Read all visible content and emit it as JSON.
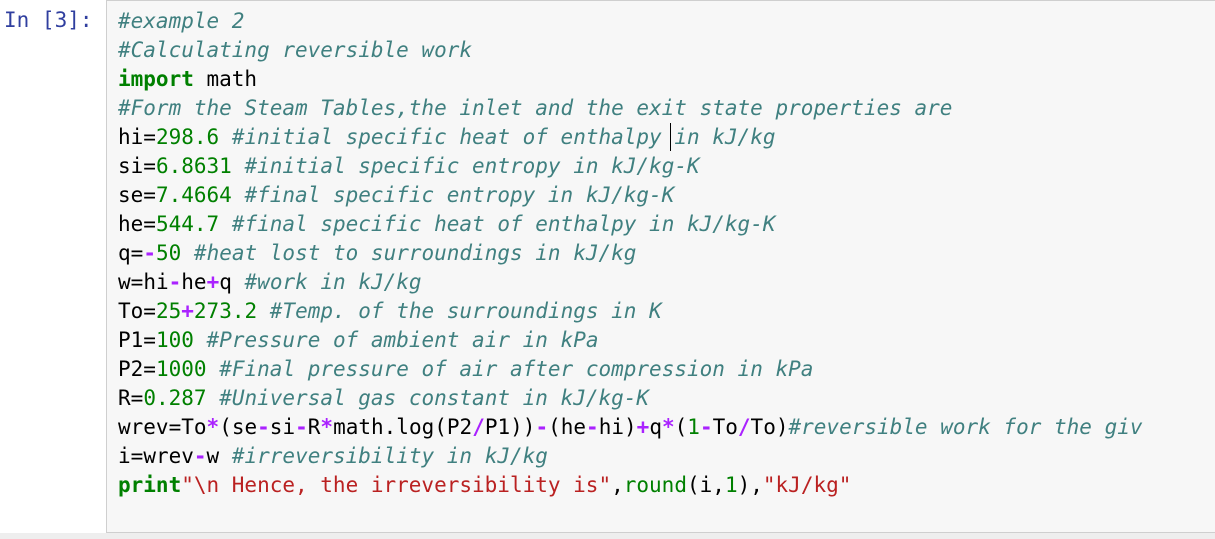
{
  "prompt": "In [3]:",
  "code_lines": [
    [
      {
        "t": "#example 2",
        "c": "cm"
      }
    ],
    [
      {
        "t": "#Calculating reversible work",
        "c": "cm"
      }
    ],
    [
      {
        "t": "import",
        "c": "kw"
      },
      {
        "t": " math",
        "c": "var"
      }
    ],
    [
      {
        "t": "#Form the Steam Tables,the inlet and the exit state properties are",
        "c": "cm"
      }
    ],
    [
      {
        "t": "hi",
        "c": "var"
      },
      {
        "t": "=",
        "c": "var"
      },
      {
        "t": "298.6",
        "c": "num"
      },
      {
        "t": " ",
        "c": "var"
      },
      {
        "t": "#initial specific heat of enthalpy in kJ/kg",
        "c": "cm"
      }
    ],
    [
      {
        "t": "si",
        "c": "var"
      },
      {
        "t": "=",
        "c": "var"
      },
      {
        "t": "6.8631",
        "c": "num"
      },
      {
        "t": " ",
        "c": "var"
      },
      {
        "t": "#initial specific entropy in kJ/kg-K",
        "c": "cm"
      }
    ],
    [
      {
        "t": "se",
        "c": "var"
      },
      {
        "t": "=",
        "c": "var"
      },
      {
        "t": "7.4664",
        "c": "num"
      },
      {
        "t": " ",
        "c": "var"
      },
      {
        "t": "#final specific entropy in kJ/kg-K",
        "c": "cm"
      }
    ],
    [
      {
        "t": "he",
        "c": "var"
      },
      {
        "t": "=",
        "c": "var"
      },
      {
        "t": "544.7",
        "c": "num"
      },
      {
        "t": " ",
        "c": "var"
      },
      {
        "t": "#final specific heat of enthalpy in kJ/kg-K",
        "c": "cm"
      }
    ],
    [
      {
        "t": "q",
        "c": "var"
      },
      {
        "t": "=",
        "c": "var"
      },
      {
        "t": "-",
        "c": "op"
      },
      {
        "t": "50",
        "c": "num"
      },
      {
        "t": " ",
        "c": "var"
      },
      {
        "t": "#heat lost to surroundings in kJ/kg",
        "c": "cm"
      }
    ],
    [
      {
        "t": "w",
        "c": "var"
      },
      {
        "t": "=",
        "c": "var"
      },
      {
        "t": "hi",
        "c": "var"
      },
      {
        "t": "-",
        "c": "op"
      },
      {
        "t": "he",
        "c": "var"
      },
      {
        "t": "+",
        "c": "op"
      },
      {
        "t": "q",
        "c": "var"
      },
      {
        "t": " ",
        "c": "var"
      },
      {
        "t": "#work in kJ/kg",
        "c": "cm"
      }
    ],
    [
      {
        "t": "To",
        "c": "var"
      },
      {
        "t": "=",
        "c": "var"
      },
      {
        "t": "25",
        "c": "num"
      },
      {
        "t": "+",
        "c": "op"
      },
      {
        "t": "273.2",
        "c": "num"
      },
      {
        "t": " ",
        "c": "var"
      },
      {
        "t": "#Temp. of the surroundings in K",
        "c": "cm"
      }
    ],
    [
      {
        "t": "P1",
        "c": "var"
      },
      {
        "t": "=",
        "c": "var"
      },
      {
        "t": "100",
        "c": "num"
      },
      {
        "t": " ",
        "c": "var"
      },
      {
        "t": "#Pressure of ambient air in kPa",
        "c": "cm"
      }
    ],
    [
      {
        "t": "P2",
        "c": "var"
      },
      {
        "t": "=",
        "c": "var"
      },
      {
        "t": "1000",
        "c": "num"
      },
      {
        "t": " ",
        "c": "var"
      },
      {
        "t": "#Final pressure of air after compression in kPa",
        "c": "cm"
      }
    ],
    [
      {
        "t": "R",
        "c": "var"
      },
      {
        "t": "=",
        "c": "var"
      },
      {
        "t": "0.287",
        "c": "num"
      },
      {
        "t": " ",
        "c": "var"
      },
      {
        "t": "#Universal gas constant in kJ/kg-K",
        "c": "cm"
      }
    ],
    [
      {
        "t": "wrev",
        "c": "var"
      },
      {
        "t": "=",
        "c": "var"
      },
      {
        "t": "To",
        "c": "var"
      },
      {
        "t": "*",
        "c": "op"
      },
      {
        "t": "(",
        "c": "var"
      },
      {
        "t": "se",
        "c": "var"
      },
      {
        "t": "-",
        "c": "op"
      },
      {
        "t": "si",
        "c": "var"
      },
      {
        "t": "-",
        "c": "op"
      },
      {
        "t": "R",
        "c": "var"
      },
      {
        "t": "*",
        "c": "op"
      },
      {
        "t": "math",
        "c": "var"
      },
      {
        "t": ".",
        "c": "var"
      },
      {
        "t": "log",
        "c": "var"
      },
      {
        "t": "(",
        "c": "var"
      },
      {
        "t": "P2",
        "c": "var"
      },
      {
        "t": "/",
        "c": "op"
      },
      {
        "t": "P1",
        "c": "var"
      },
      {
        "t": "))",
        "c": "var"
      },
      {
        "t": "-",
        "c": "op"
      },
      {
        "t": "(",
        "c": "var"
      },
      {
        "t": "he",
        "c": "var"
      },
      {
        "t": "-",
        "c": "op"
      },
      {
        "t": "hi",
        "c": "var"
      },
      {
        "t": ")",
        "c": "var"
      },
      {
        "t": "+",
        "c": "op"
      },
      {
        "t": "q",
        "c": "var"
      },
      {
        "t": "*",
        "c": "op"
      },
      {
        "t": "(",
        "c": "var"
      },
      {
        "t": "1",
        "c": "num"
      },
      {
        "t": "-",
        "c": "op"
      },
      {
        "t": "To",
        "c": "var"
      },
      {
        "t": "/",
        "c": "op"
      },
      {
        "t": "To",
        "c": "var"
      },
      {
        "t": ")",
        "c": "var"
      },
      {
        "t": "#reversible work for the giv",
        "c": "cm"
      }
    ],
    [
      {
        "t": "i",
        "c": "var"
      },
      {
        "t": "=",
        "c": "var"
      },
      {
        "t": "wrev",
        "c": "var"
      },
      {
        "t": "-",
        "c": "op"
      },
      {
        "t": "w",
        "c": "var"
      },
      {
        "t": " ",
        "c": "var"
      },
      {
        "t": "#irreversibility in kJ/kg",
        "c": "cm"
      }
    ],
    [
      {
        "t": "print",
        "c": "kw"
      },
      {
        "t": "\"\\n Hence, the irreversibility is\"",
        "c": "str"
      },
      {
        "t": ",",
        "c": "var"
      },
      {
        "t": "round",
        "c": "num"
      },
      {
        "t": "(",
        "c": "var"
      },
      {
        "t": "i",
        "c": "var"
      },
      {
        "t": ",",
        "c": "var"
      },
      {
        "t": "1",
        "c": "num"
      },
      {
        "t": "),",
        "c": "var"
      },
      {
        "t": "\"kJ/kg\"",
        "c": "str"
      }
    ]
  ]
}
